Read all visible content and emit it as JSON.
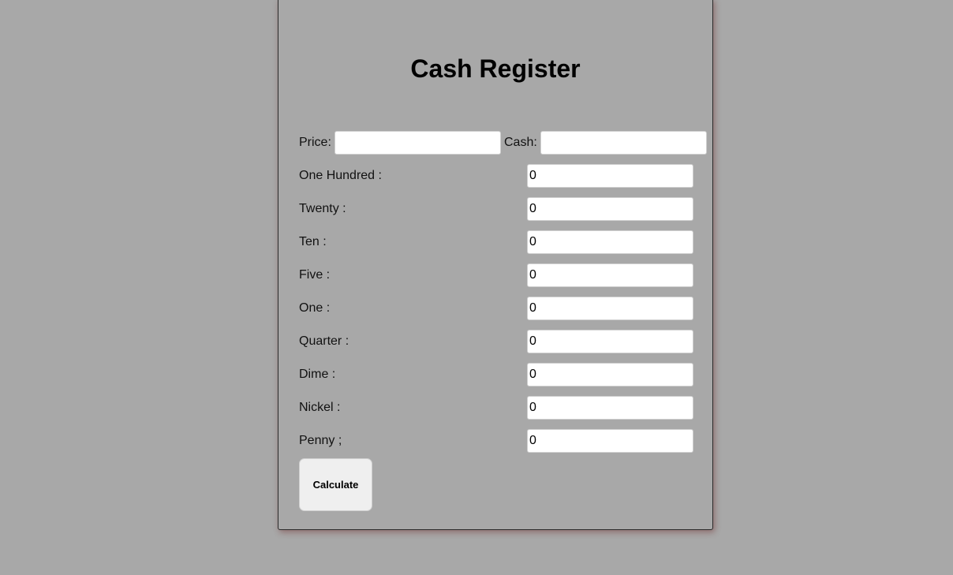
{
  "title": "Cash Register",
  "price": {
    "label": "Price:",
    "value": ""
  },
  "cash": {
    "label": "Cash:",
    "value": ""
  },
  "denominations": [
    {
      "label": "One Hundred :",
      "value": "0"
    },
    {
      "label": "Twenty :",
      "value": "0"
    },
    {
      "label": "Ten :",
      "value": "0"
    },
    {
      "label": "Five :",
      "value": "0"
    },
    {
      "label": "One :",
      "value": "0"
    },
    {
      "label": "Quarter :",
      "value": "0"
    },
    {
      "label": "Dime :",
      "value": "0"
    },
    {
      "label": "Nickel :",
      "value": "0"
    },
    {
      "label": "Penny ;",
      "value": "0"
    }
  ],
  "calculate_label": "Calculate",
  "colors": {
    "background": "#a8a8a8",
    "field_background": "#ffffff",
    "button_background": "#efefef"
  }
}
